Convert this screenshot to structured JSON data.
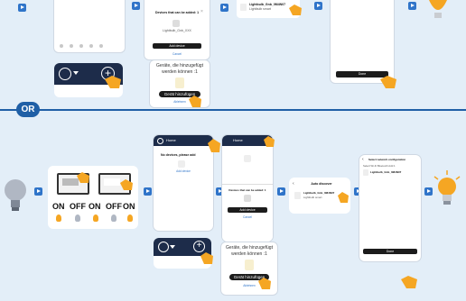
{
  "divider": {
    "badge": "OR"
  },
  "step_add": {
    "modal_title": "Devices that can be added: 1",
    "device_label": "Lightbulb_Gnb_XXX",
    "add_button": "Add device",
    "cancel_link": "Cancel"
  },
  "found_item": {
    "name": "Lightbulb_Gnb_0M4N07",
    "sub": "Lightbulb smart"
  },
  "done_button": "Done",
  "bubble": {
    "line1": "Geräte, die hinzugefügt",
    "line2": "werden können :1",
    "button": "Gerät hinzufügen",
    "link": "Ablehnen"
  },
  "bubble2": {
    "line1": "Geräte, die hinzugefügt",
    "line2": "werden können :1",
    "button": "Gerät hinzufügen",
    "link": "Ablehnen"
  },
  "row2": {
    "app_header": "Home",
    "no_devices": "No devices, please add",
    "add_link": "Add device",
    "add_modal_title": "Devices that can be added: 1",
    "add_button": "Add device",
    "cancel_link": "Cancel",
    "auto_discover_title": "Auto discover",
    "network_title": "Select network configuration",
    "network_step": "Select Wi-Fi  Bluetooth  Add 1",
    "network_item": "Lightbulb_Gnb_0M4N07",
    "done_button": "Done"
  },
  "toggle_labels": {
    "on": "ON",
    "off": "OFF"
  },
  "colors": {
    "accent": "#1f5fa6",
    "arrow": "#2f74c9",
    "bulb_on": "#f5a623",
    "bulb_off": "#b0b7c3",
    "background": "#e3eef8"
  }
}
